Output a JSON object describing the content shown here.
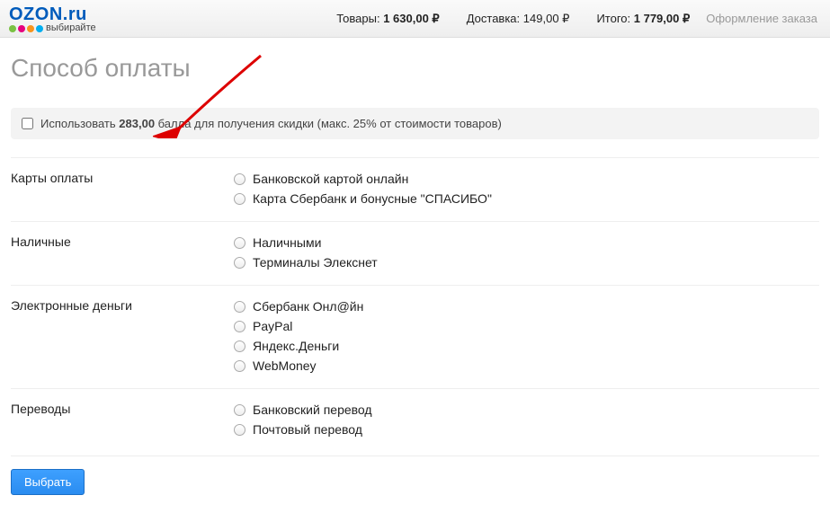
{
  "header": {
    "logo_main": "OZON.ru",
    "logo_tagline": "выбирайте",
    "goods_label": "Товары:",
    "goods_value": "1 630,00 ₽",
    "delivery_label": "Доставка:",
    "delivery_value": "149,00 ₽",
    "total_label": "Итого:",
    "total_value": "1 779,00 ₽",
    "breadcrumb": "Оформление заказа"
  },
  "title": "Способ оплаты",
  "promo": {
    "prefix": "Использовать ",
    "points": "283,00",
    "suffix": " балла для получения скидки (макс. 25% от стоимости товаров)"
  },
  "groups": [
    {
      "label": "Карты оплаты",
      "options": [
        "Банковской картой онлайн",
        "Карта Сбербанк и бонусные \"СПАСИБО\""
      ]
    },
    {
      "label": "Наличные",
      "options": [
        "Наличными",
        "Терминалы Элекснет"
      ]
    },
    {
      "label": "Электронные деньги",
      "options": [
        "Сбербанк Онл@йн",
        "PayPal",
        "Яндекс.Деньги",
        "WebMoney"
      ]
    },
    {
      "label": "Переводы",
      "options": [
        "Банковский перевод",
        "Почтовый перевод"
      ]
    }
  ],
  "submit_label": "Выбрать"
}
